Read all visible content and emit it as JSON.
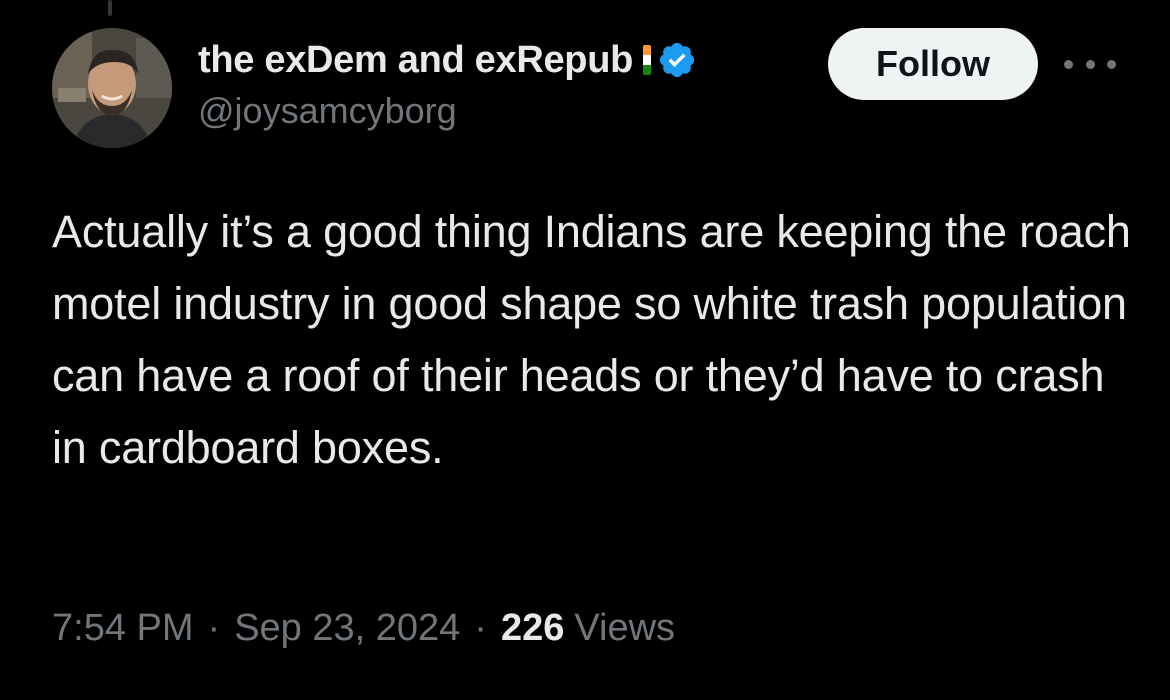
{
  "tweet": {
    "author": {
      "display_name": "the exDem and exRepub",
      "handle": "@joysamcyborg",
      "flag_icon": "india-flag-icon",
      "verified_icon": "verified-badge-icon",
      "verified_color": "#1d9bf0",
      "avatar_icon": "profile-avatar"
    },
    "follow_label": "Follow",
    "more_icon": "more-options-icon",
    "text": "Actually it’s a good thing Indians are keeping the roach motel industry in good shape so white trash population can have a roof of their heads or they’d have to crash in cardboard boxes.",
    "time": "7:54 PM",
    "separator": "·",
    "date": "Sep 23, 2024",
    "views_count": "226",
    "views_label": "Views"
  },
  "colors": {
    "background": "#000000",
    "primary_text": "#e7e9ea",
    "secondary_text": "#71767b",
    "follow_button_bg": "#eff3f4",
    "follow_button_text": "#0f1419",
    "flag_saffron": "#ff9933",
    "flag_white": "#ffffff",
    "flag_green": "#138808"
  }
}
